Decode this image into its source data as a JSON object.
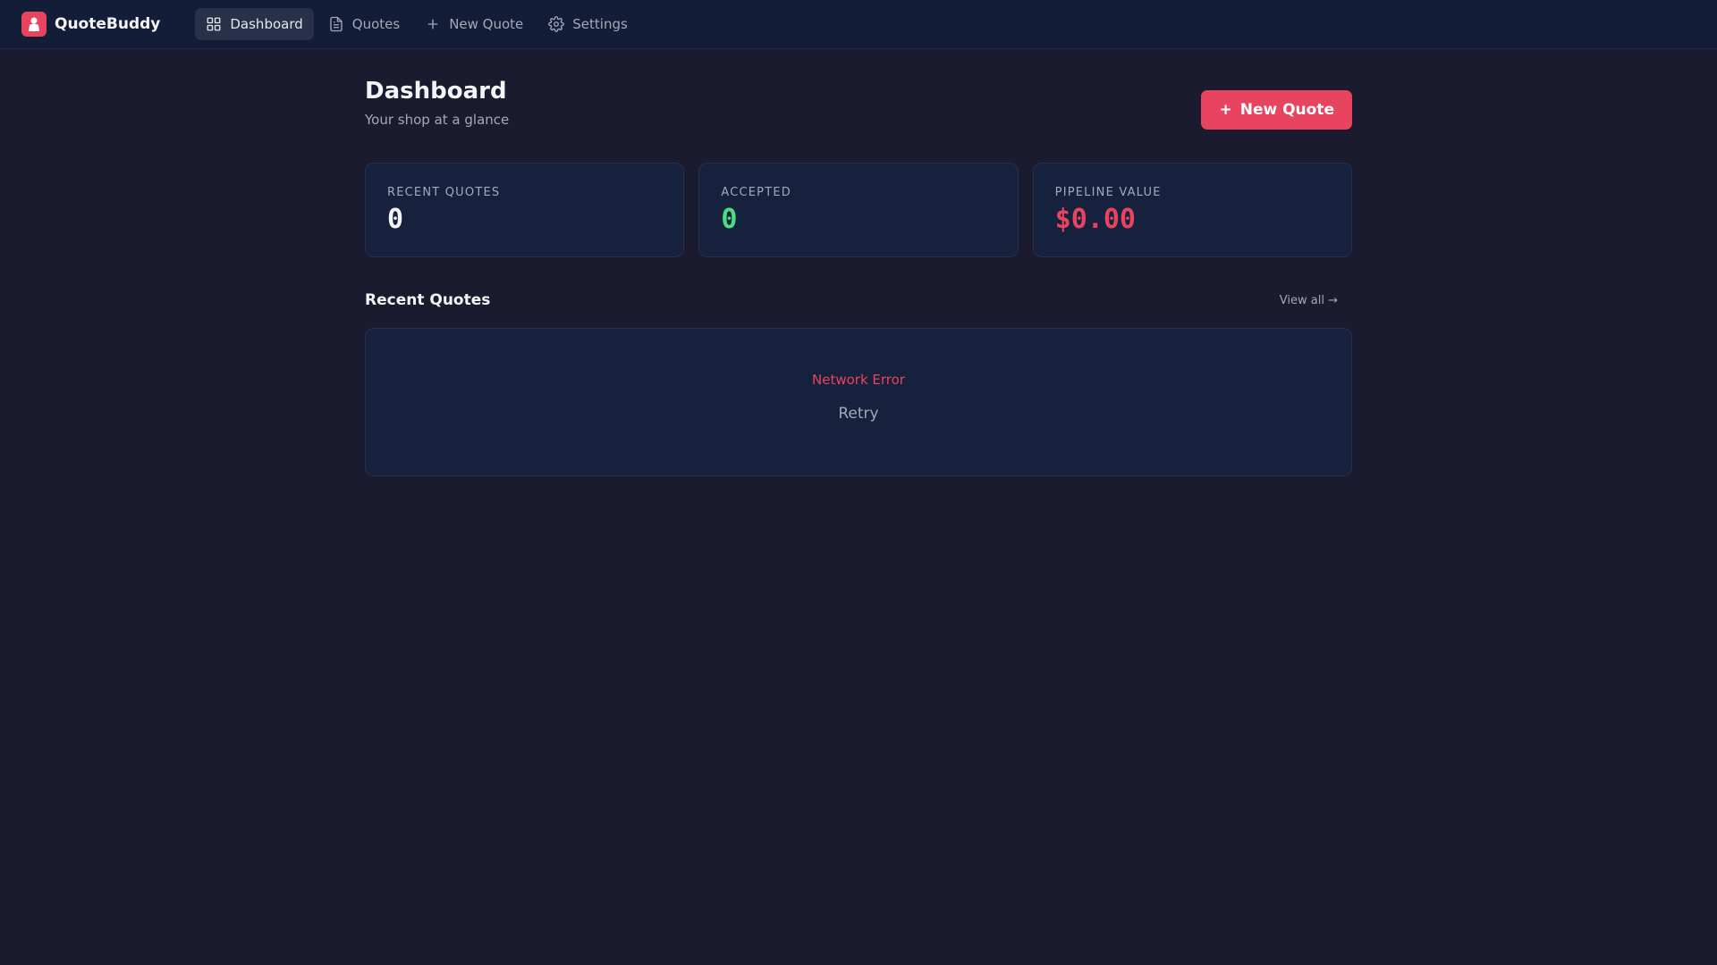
{
  "app": {
    "name": "QuoteBuddy"
  },
  "nav": {
    "items": [
      {
        "label": "Dashboard",
        "icon": "grid-icon",
        "active": true
      },
      {
        "label": "Quotes",
        "icon": "document-icon"
      },
      {
        "label": "New Quote",
        "icon": "plus-icon"
      },
      {
        "label": "Settings",
        "icon": "gear-icon"
      }
    ]
  },
  "header": {
    "title": "Dashboard",
    "subtitle": "Your shop at a glance",
    "new_quote_label": "New Quote"
  },
  "stats": [
    {
      "label": "RECENT QUOTES",
      "value": "0",
      "color": "#f3f4f6"
    },
    {
      "label": "ACCEPTED",
      "value": "0",
      "color": "#4ade80"
    },
    {
      "label": "PIPELINE VALUE",
      "value": "$0.00",
      "color": "#e8445f"
    }
  ],
  "recent": {
    "title": "Recent Quotes",
    "view_all": "View all →",
    "error": "Network Error",
    "retry": "Retry"
  }
}
